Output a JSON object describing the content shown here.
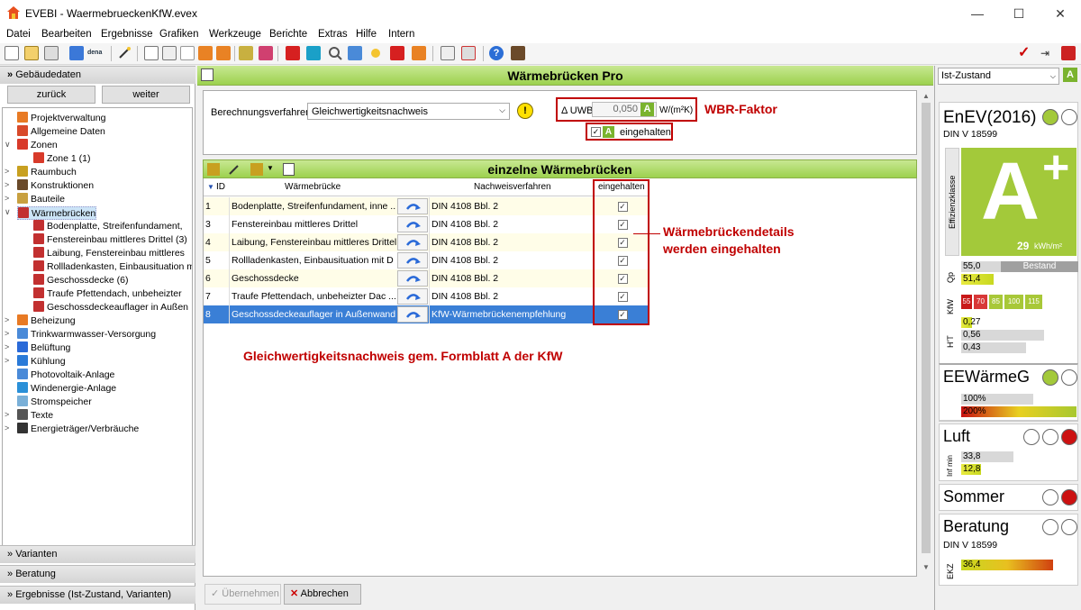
{
  "window": {
    "title": "EVEBI - WaermebrueckenKfW.evex",
    "min": "—",
    "max": "☐",
    "close": "✕"
  },
  "menu": [
    "Datei",
    "Bearbeiten",
    "Ergebnisse",
    "Grafiken",
    "Werkzeuge",
    "Berichte",
    "Extras",
    "Hilfe",
    "Intern"
  ],
  "left": {
    "header": "Gebäudedaten",
    "back": "zurück",
    "forward": "weiter",
    "tree": [
      {
        "label": "Projektverwaltung",
        "lvl": 0,
        "exp": ""
      },
      {
        "label": "Allgemeine Daten",
        "lvl": 0,
        "exp": ""
      },
      {
        "label": "Zonen",
        "lvl": 0,
        "exp": "∨"
      },
      {
        "label": "Zone 1 (1)",
        "lvl": 1,
        "exp": ""
      },
      {
        "label": "Raumbuch",
        "lvl": 0,
        "exp": ">"
      },
      {
        "label": "Konstruktionen",
        "lvl": 0,
        "exp": ">"
      },
      {
        "label": "Bauteile",
        "lvl": 0,
        "exp": ">"
      },
      {
        "label": "Wärmebrücken",
        "lvl": 0,
        "exp": "∨",
        "sel": true
      },
      {
        "label": "Bodenplatte, Streifenfundament,",
        "lvl": 1,
        "exp": ""
      },
      {
        "label": "Fenstereinbau mittleres Drittel (3)",
        "lvl": 1,
        "exp": ""
      },
      {
        "label": "Laibung, Fenstereinbau mittleres",
        "lvl": 1,
        "exp": ""
      },
      {
        "label": "Rollladenkasten, Einbausituation m",
        "lvl": 1,
        "exp": ""
      },
      {
        "label": "Geschossdecke (6)",
        "lvl": 1,
        "exp": ""
      },
      {
        "label": "Traufe Pfettendach, unbeheizter",
        "lvl": 1,
        "exp": ""
      },
      {
        "label": "Geschossdeckeauflager in Außen",
        "lvl": 1,
        "exp": ""
      },
      {
        "label": "Beheizung",
        "lvl": 0,
        "exp": ">"
      },
      {
        "label": "Trinkwarmwasser-Versorgung",
        "lvl": 0,
        "exp": ">"
      },
      {
        "label": "Belüftung",
        "lvl": 0,
        "exp": ">"
      },
      {
        "label": "Kühlung",
        "lvl": 0,
        "exp": ">"
      },
      {
        "label": "Photovoltaik-Anlage",
        "lvl": 0,
        "exp": ""
      },
      {
        "label": "Windenergie-Anlage",
        "lvl": 0,
        "exp": ""
      },
      {
        "label": "Stromspeicher",
        "lvl": 0,
        "exp": ""
      },
      {
        "label": "Texte",
        "lvl": 0,
        "exp": ">"
      },
      {
        "label": "Energieträger/Verbräuche",
        "lvl": 0,
        "exp": ">"
      }
    ],
    "sections": [
      "Varianten",
      "Beratung",
      "Ergebnisse (Ist-Zustand, Varianten)"
    ]
  },
  "main": {
    "title": "Wärmebrücken Pro",
    "method_label": "Berechnungsverfahren",
    "method_value": "Gleichwertigkeitsnachweis",
    "delta_label": "Δ UWB",
    "delta_value": "0,050",
    "delta_unit": "W/(m²K)",
    "wbr_label": "WBR-Faktor",
    "met_label": "eingehalten",
    "grid_title": "einzelne Wärmebrücken",
    "columns": [
      "ID",
      "Wärmebrücke",
      "Nachweisverfahren",
      "eingehalten"
    ],
    "rows": [
      {
        "id": "1",
        "name": "Bodenplatte, Streifenfundament, inne ...",
        "proof": "DIN 4108 Bbl. 2"
      },
      {
        "id": "3",
        "name": "Fenstereinbau mittleres Drittel",
        "proof": "DIN 4108 Bbl. 2"
      },
      {
        "id": "4",
        "name": "Laibung, Fenstereinbau mittleres Drittel",
        "proof": "DIN 4108 Bbl. 2"
      },
      {
        "id": "5",
        "name": "Rollladenkasten, Einbausituation mit D ...",
        "proof": "DIN 4108 Bbl. 2"
      },
      {
        "id": "6",
        "name": "Geschossdecke",
        "proof": "DIN 4108 Bbl. 2"
      },
      {
        "id": "7",
        "name": "Traufe Pfettendach, unbeheizter Dac ...",
        "proof": "DIN 4108 Bbl. 2"
      },
      {
        "id": "8",
        "name": "Geschossdeckeauflager in Außenwand",
        "proof": "KfW-Wärmebrückenempfehlung"
      }
    ],
    "note1": "Wärmebrückendetails",
    "note2": "werden eingehalten",
    "note3": "Gleichwertigkeitsnachweis gem. Formblatt A der KfW",
    "apply": "Übernehmen",
    "cancel": "Abbrechen"
  },
  "right": {
    "state": "Ist-Zustand",
    "enev": "EnEV(2016)",
    "din": "DIN V 18599",
    "eff_label": "Effizienzklasse",
    "grade": "A",
    "plus": "+",
    "kwh": "29",
    "kwh_unit": "kWh/m²",
    "qp1": "55,0",
    "qp_label": "Bestand",
    "qp2": "51,4",
    "qp_axis": "Qp",
    "kfw_axis": "KfW",
    "kfw": [
      "55",
      "70",
      "85",
      "100",
      "115"
    ],
    "ht_axis": "H'T",
    "ht": [
      "0,27",
      "0,56",
      "0,43"
    ],
    "ee": "EEWärmeG",
    "ee1": "100%",
    "ee2": "200%",
    "luft": "Luft",
    "inf_axis": "Inf min",
    "l1": "33,8",
    "l2": "12,8",
    "sommer": "Sommer",
    "beratung": "Beratung",
    "din2": "DIN V 18599",
    "ekz_axis": "EKZ",
    "ekz": "36,4",
    "colors": {
      "green": "#a3c93a",
      "red": "#cc1111"
    }
  }
}
